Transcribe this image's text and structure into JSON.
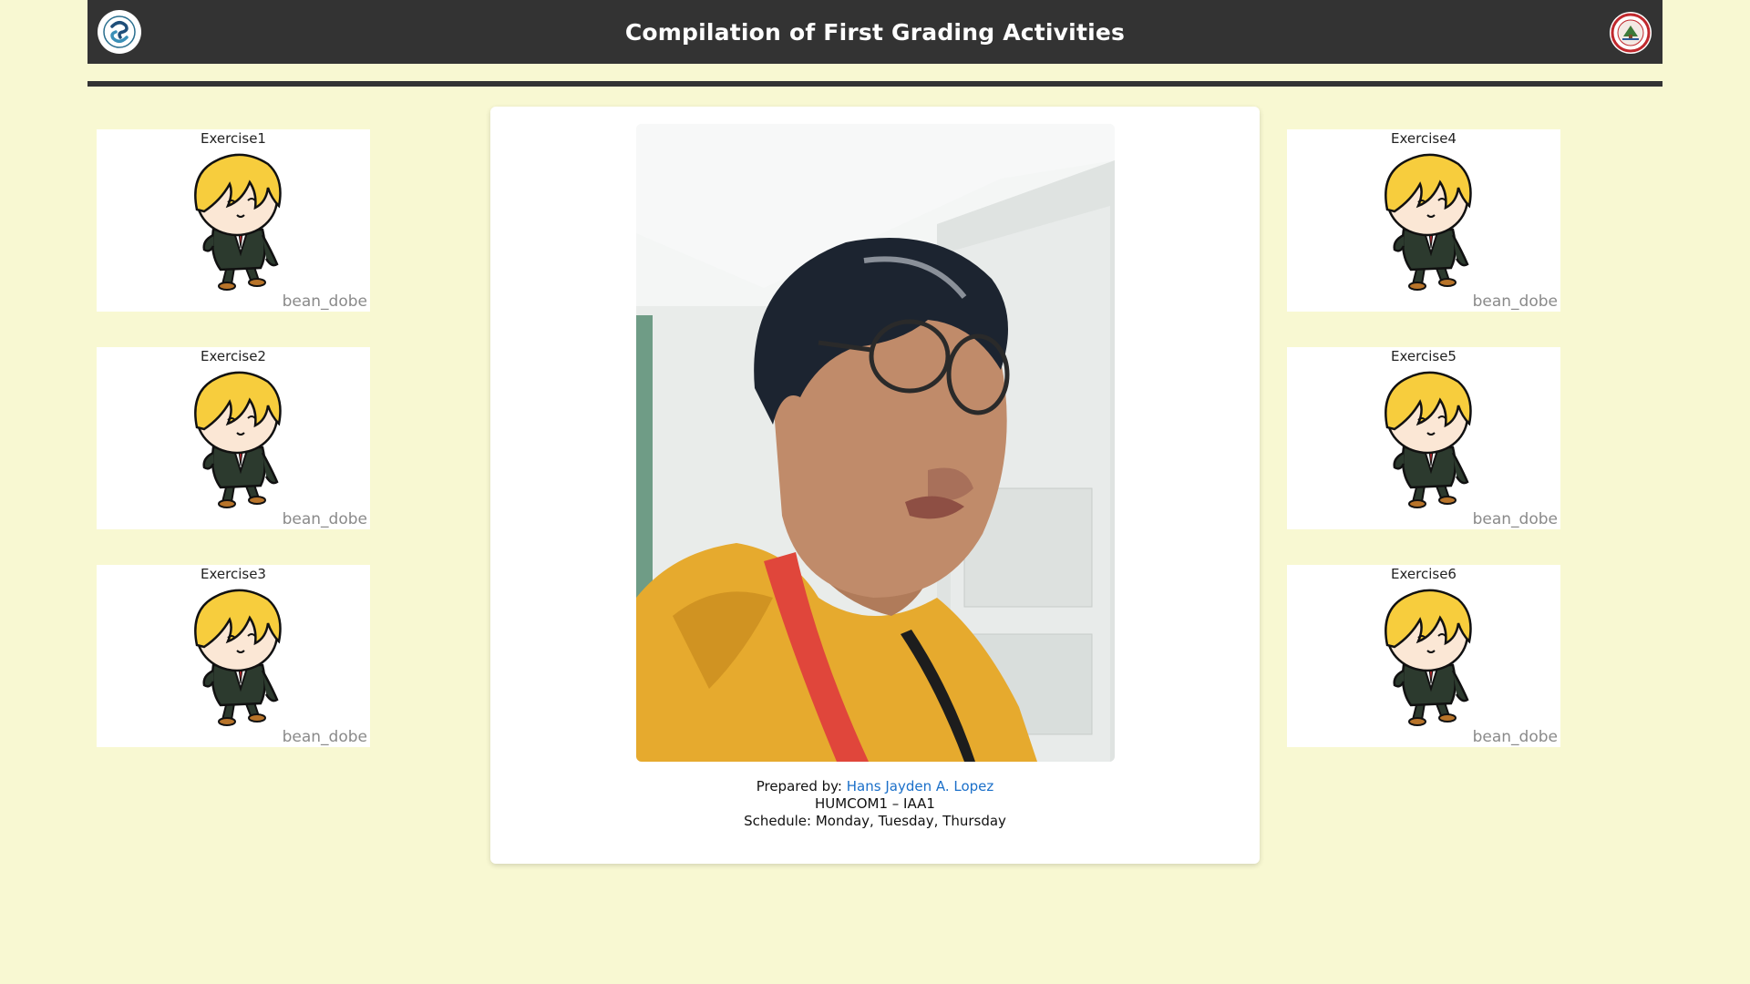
{
  "header": {
    "title": "Compilation of First Grading Activities",
    "left_logo_icon": "swirl-logo-icon",
    "right_logo_icon": "school-seal-icon",
    "background": "#333333"
  },
  "exercises_left": [
    {
      "label": "Exercise1",
      "watermark": "bean_dobe"
    },
    {
      "label": "Exercise2",
      "watermark": "bean_dobe"
    },
    {
      "label": "Exercise3",
      "watermark": "bean_dobe"
    }
  ],
  "exercises_right": [
    {
      "label": "Exercise4",
      "watermark": "bean_dobe"
    },
    {
      "label": "Exercise5",
      "watermark": "bean_dobe"
    },
    {
      "label": "Exercise6",
      "watermark": "bean_dobe"
    }
  ],
  "profile": {
    "prepared_by_label": "Prepared by:",
    "name": "Hans Jayden A. Lopez",
    "course": "HUMCOM1 – IAA1",
    "schedule": "Schedule: Monday, Tuesday, Thursday"
  },
  "colors": {
    "page_background": "#f8f8d2",
    "link": "#1a6fc9"
  }
}
